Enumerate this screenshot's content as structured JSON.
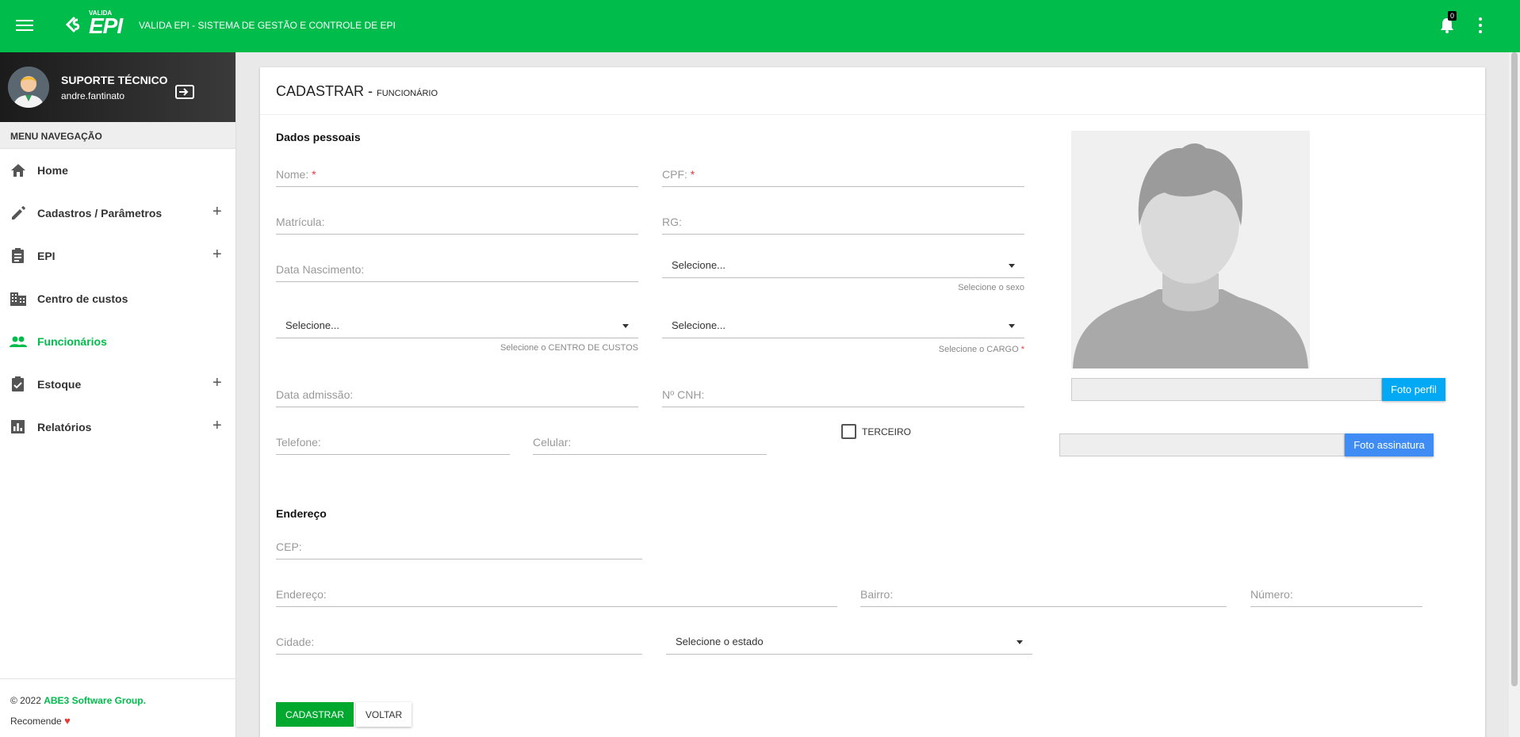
{
  "header": {
    "logo_small": "VALIDA",
    "logo_text": "EPI",
    "title": "VALIDA EPI - SISTEMA DE GESTÃO E CONTROLE DE EPI",
    "notifications_count": "0",
    "brand_color": "#00bc4b"
  },
  "sidebar": {
    "user": {
      "name": "SUPORTE TÉCNICO",
      "login": "andre.fantinato"
    },
    "menu_header": "MENU NAVEGAÇÃO",
    "items": [
      {
        "label": "Home",
        "icon": "home-icon",
        "expandable": false
      },
      {
        "label": "Cadastros / Parâmetros",
        "icon": "pencil-icon",
        "expandable": true
      },
      {
        "label": "EPI",
        "icon": "clipboard-icon",
        "expandable": true
      },
      {
        "label": "Centro de custos",
        "icon": "building-icon",
        "expandable": false
      },
      {
        "label": "Funcionários",
        "icon": "people-icon",
        "expandable": false,
        "active": true
      },
      {
        "label": "Estoque",
        "icon": "clipboard-check-icon",
        "expandable": true
      },
      {
        "label": "Relatórios",
        "icon": "bar-chart-icon",
        "expandable": true
      }
    ],
    "plus_symbol": "+",
    "footer": {
      "copyright": "© 2022",
      "company": "ABE3 Software Group",
      "dot": ".",
      "recommend": "Recomende",
      "heart": "♥"
    }
  },
  "form": {
    "title": "CADASTRAR - ",
    "subtitle": "FUNCIONÁRIO",
    "personal_section": "Dados pessoais",
    "nome": "Nome:",
    "cpf": "CPF:",
    "required_mark": "*",
    "matricula": "Matrícula:",
    "rg": "RG:",
    "data_nascimento": "Data Nascimento:",
    "sexo_select": "Selecione...",
    "sexo_helper": "Selecione o sexo",
    "centro_select": "Selecione...",
    "centro_helper": "Selecione o CENTRO DE CUSTOS",
    "cargo_select": "Selecione...",
    "cargo_helper": "Selecione o CARGO",
    "data_admissao": "Data admissão:",
    "cnh": "Nº CNH:",
    "telefone": "Telefone:",
    "celular": "Celular:",
    "terceiro": "TERCEIRO",
    "foto_perfil": "Foto perfil",
    "foto_assinatura": "Foto assinatura",
    "address_section": "Endereço",
    "cep": "CEP:",
    "endereco": "Endereço:",
    "bairro": "Bairro:",
    "numero": "Número:",
    "cidade": "Cidade:",
    "estado_select": "Selecione o estado",
    "submit": "CADASTRAR",
    "back": "VOLTAR"
  }
}
